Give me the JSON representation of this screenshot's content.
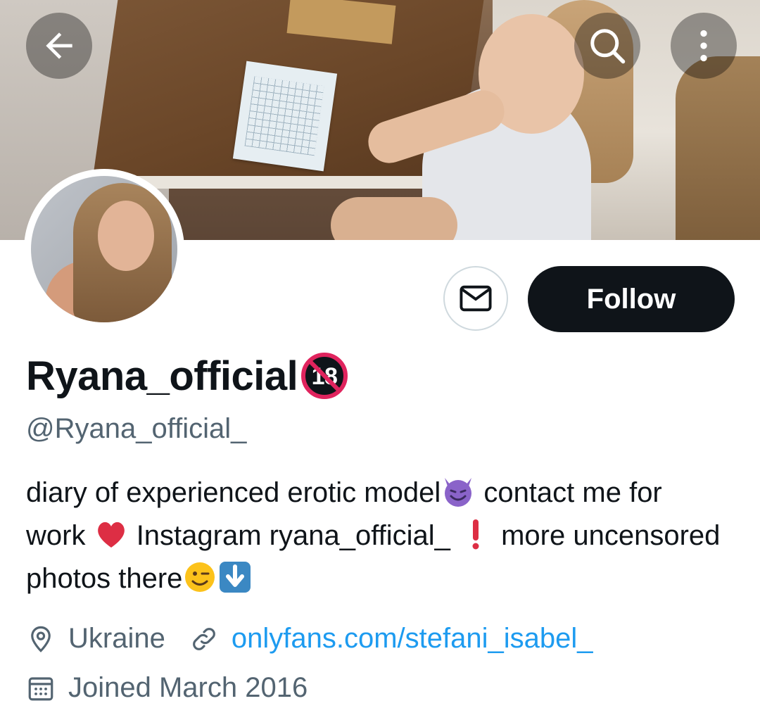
{
  "profile": {
    "display_name": "Ryana_official",
    "handle": "@Ryana_official_",
    "bio": {
      "part1": "diary of experienced erotic model",
      "part2": " contact me for work ",
      "part3": " Instagram ryana_official_ ",
      "part4": " more uncensored photos there"
    },
    "location": "Ukraine",
    "website": "onlyfans.com/stefani_isabel_",
    "joined": "Joined March 2016"
  },
  "actions": {
    "follow_label": "Follow"
  },
  "badge": {
    "text": "18"
  },
  "colors": {
    "link": "#1d9bf0",
    "secondary_text": "#536471",
    "follow_bg": "#0f1419"
  },
  "icons": {
    "back": "arrow-left-icon",
    "search": "search-icon",
    "more": "more-vertical-icon",
    "message": "envelope-icon",
    "location": "location-pin-icon",
    "link": "link-icon",
    "calendar": "calendar-icon"
  }
}
